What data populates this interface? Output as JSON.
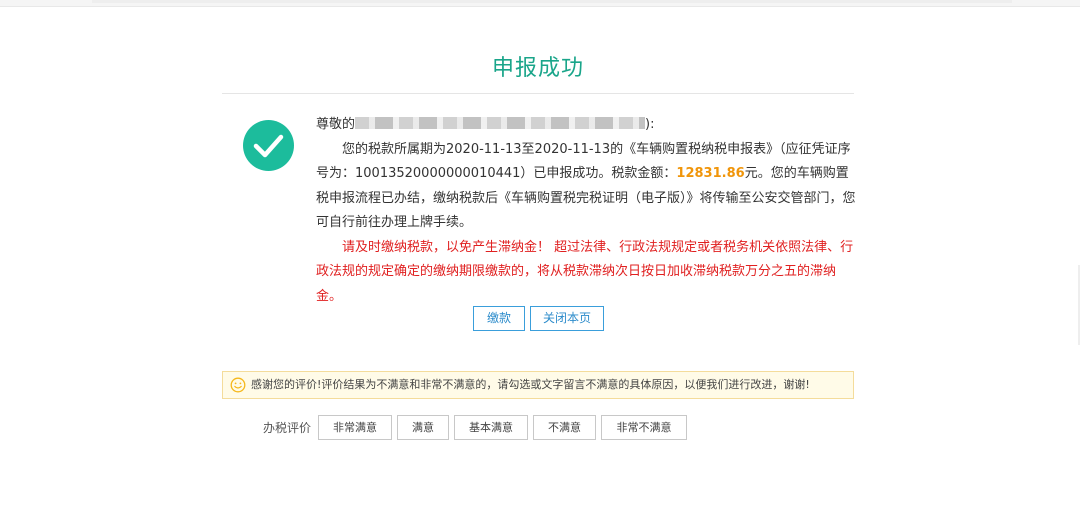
{
  "page": {
    "title": "申报成功"
  },
  "message": {
    "greeting_prefix": "尊敬的",
    "greeting_suffix": "):",
    "body_1": "您的税款所属期为2020-11-13至2020-11-13的《车辆购置税纳税申报表》（应征凭证序号为：10013520000000010441）已申报成功。税款金额：",
    "amount": "12831.86",
    "body_2": "元。您的车辆购置税申报流程已办结，缴纳税款后《车辆购置税完税证明（电子版）》将传输至公安交管部门，您可自行前往办理上牌手续。",
    "warning": "请及时缴纳税款，以免产生滞纳金！ 超过法律、行政法规规定或者税务机关依照法律、行政法规的规定确定的缴纳期限缴款的，将从税款滞纳次日按日加收滞纳税款万分之五的滞纳金。"
  },
  "actions": {
    "pay_label": "缴款",
    "close_label": "关闭本页"
  },
  "notice": {
    "text": "感谢您的评价!评价结果为不满意和非常不满意的，请勾选或文字留言不满意的具体原因，以便我们进行改进，谢谢!"
  },
  "rating": {
    "label": "办税评价",
    "options": [
      "非常满意",
      "满意",
      "基本满意",
      "不满意",
      "非常不满意"
    ]
  },
  "icons": {
    "success": "check-circle-icon",
    "notice": "smile-icon"
  },
  "colors": {
    "title": "#1aa58a",
    "success_icon": "#1cbc9c",
    "amount": "#f0950a",
    "warning": "#e02020",
    "button_border": "#3a9edb",
    "notice_background": "#fffbe8",
    "notice_border": "#f4dc9b",
    "smile_icon": "#f5b81c"
  }
}
